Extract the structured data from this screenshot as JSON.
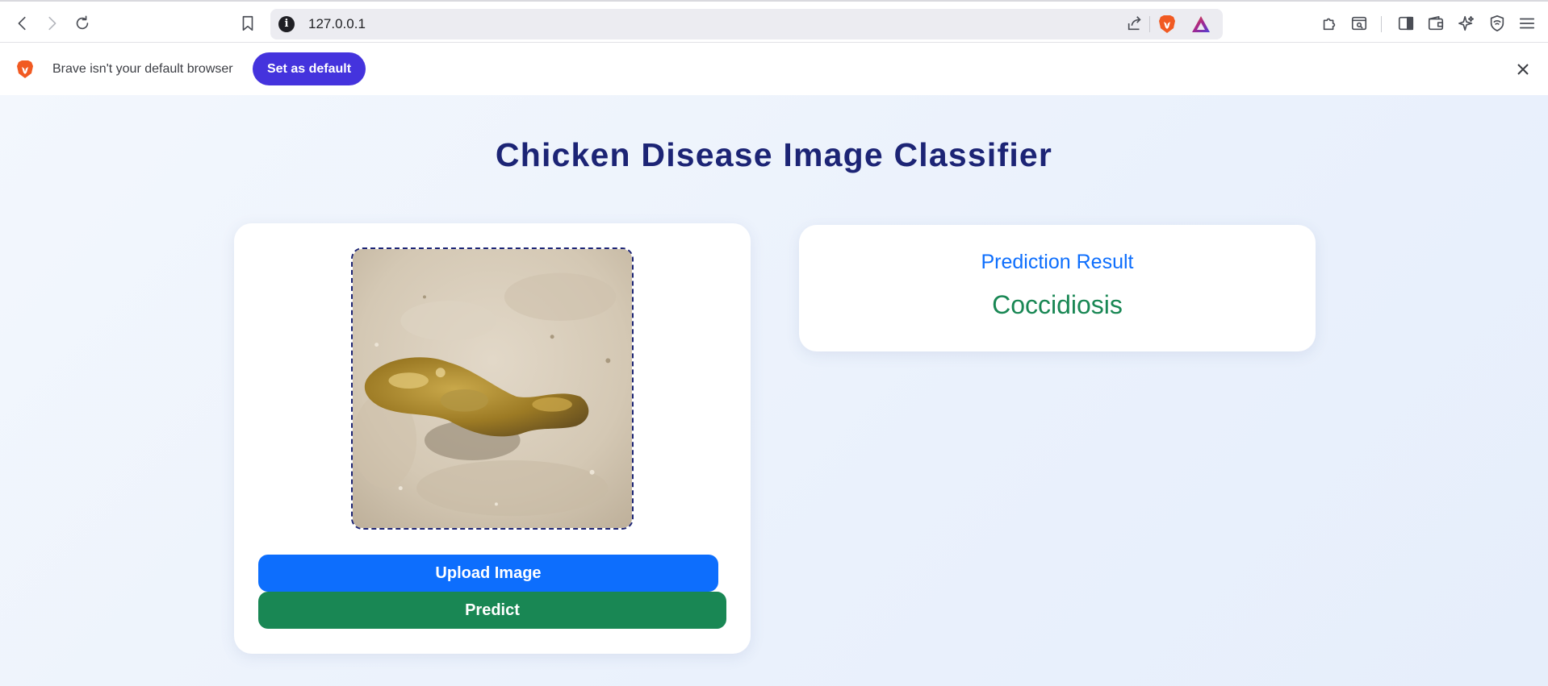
{
  "browser": {
    "url": "127.0.0.1",
    "info_icon": "i",
    "icons": {
      "back": "back-arrow-icon",
      "forward": "forward-arrow-icon",
      "reload": "reload-icon",
      "bookmark": "bookmark-icon",
      "share": "share-icon",
      "brave_shields": "brave-lion-icon",
      "rewards": "brave-rewards-icon",
      "extensions": "puzzle-icon",
      "search_tab": "tab-search-icon",
      "sidebar": "sidebar-icon",
      "wallet": "wallet-icon",
      "leo": "sparkle-icon",
      "vpn": "shield-wifi-icon",
      "menu": "hamburger-menu-icon"
    }
  },
  "infobar": {
    "message": "Brave isn't your default browser",
    "button_label": "Set as default"
  },
  "page": {
    "title": "Chicken Disease Image Classifier",
    "upload_label": "Upload Image",
    "predict_label": "Predict",
    "result_heading": "Prediction Result",
    "result_value": "Coccidiosis"
  },
  "colors": {
    "title": "#1c2475",
    "upload_button": "#0d6efd",
    "predict_button": "#198754",
    "result_heading": "#0d6efd",
    "result_value": "#198754",
    "set_default_button": "#4433dd"
  }
}
